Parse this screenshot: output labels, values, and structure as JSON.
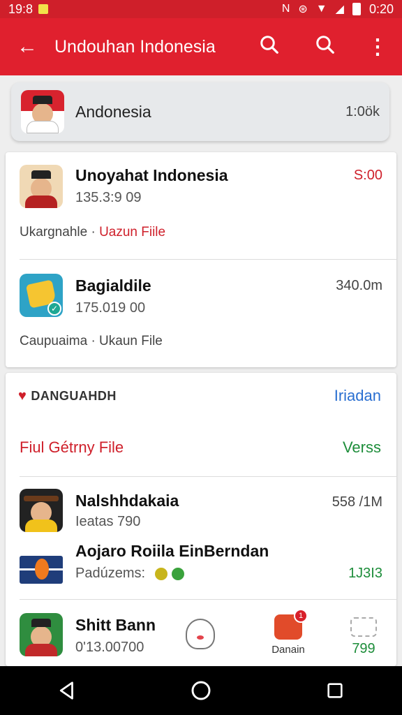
{
  "status_bar": {
    "time": "19:8",
    "right_time": "0:20",
    "icons": [
      "nfc-icon",
      "vibrate-icon",
      "wifi-icon",
      "signal-icon",
      "battery-icon"
    ]
  },
  "app_bar": {
    "title": "Undouhan Indonesia",
    "back_icon": "back-arrow-icon",
    "actions": [
      "search-icon",
      "search-icon",
      "more-vert-icon"
    ]
  },
  "search_card": {
    "name": "Andonesia",
    "size": "1:0ök"
  },
  "downloads": [
    {
      "title": "Unoyahat Indonesia",
      "subtitle": "135.3:9 09",
      "right": "S:00",
      "meta_prefix": "Ukargnahle ·",
      "meta_link": "Uazun Fiile"
    },
    {
      "title": "Bagialdile",
      "subtitle": "175.019 00",
      "right": "340.0m",
      "meta_prefix": "Caupuaima · Ukaun File",
      "meta_link": ""
    }
  ],
  "section": {
    "header": "DANGUAHDH",
    "link": "Iriadan",
    "category": "Fiul Gétrny File",
    "category_right": "Verss"
  },
  "list": [
    {
      "title": "Nalshhdakaia",
      "subtitle": "Ieatas 790",
      "right": "558 /1M"
    },
    {
      "title": "Aojaro Roiila EinBerndan",
      "subtitle": "Padúzems:",
      "right": "1J3I3"
    },
    {
      "title": "Shitt Bann",
      "subtitle": "0'13.00700"
    }
  ],
  "bottom_items": {
    "ghost_label": "",
    "home_label": "Danain",
    "home_badge": "1",
    "grid_value": "799"
  },
  "colors": {
    "primary": "#e0202e",
    "status_bar": "#cf1f2a",
    "link_blue": "#2a6fd1",
    "accent_green": "#1d8d3a"
  }
}
